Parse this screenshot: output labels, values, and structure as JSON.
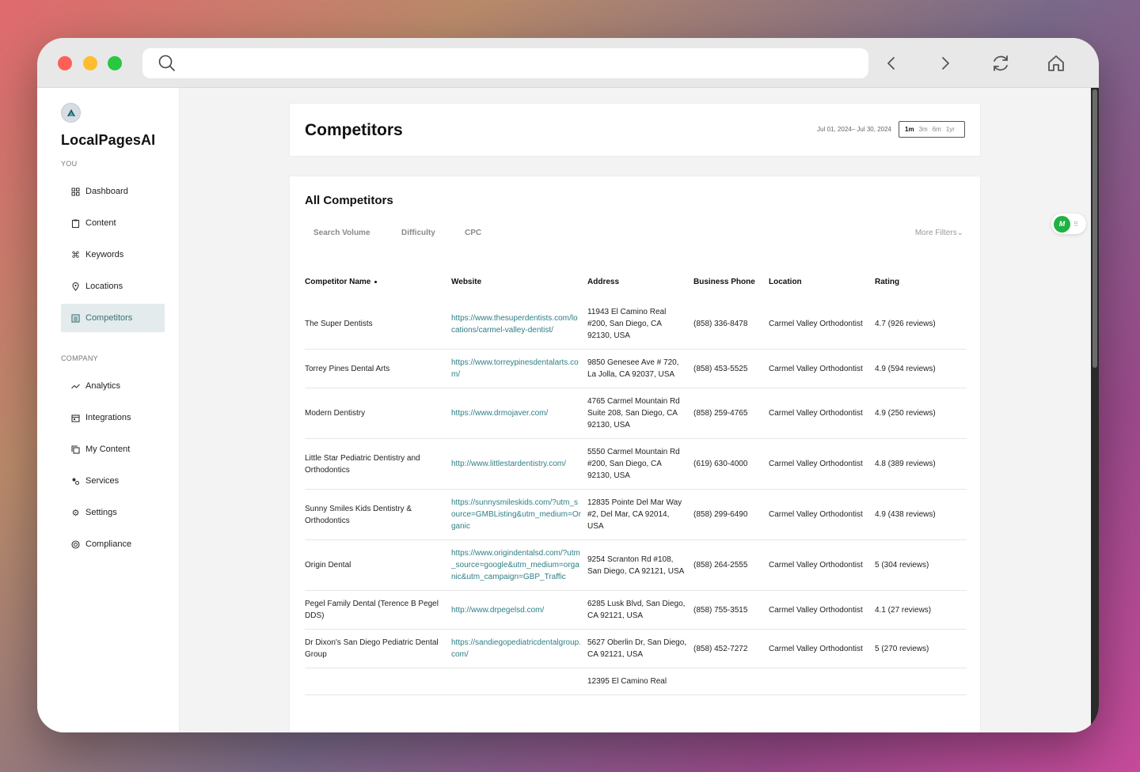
{
  "browser": {
    "url": ""
  },
  "sidebar": {
    "brand": "LocalPagesAI",
    "section_you": "YOU",
    "section_company": "COMPANY",
    "you_items": [
      {
        "label": "Dashboard",
        "icon": "grid-icon"
      },
      {
        "label": "Content",
        "icon": "clipboard-icon"
      },
      {
        "label": "Keywords",
        "icon": "command-icon"
      },
      {
        "label": "Locations",
        "icon": "pin-icon"
      },
      {
        "label": "Competitors",
        "icon": "list-icon",
        "active": true
      }
    ],
    "company_items": [
      {
        "label": "Analytics",
        "icon": "trend-icon"
      },
      {
        "label": "Integrations",
        "icon": "calendar-icon"
      },
      {
        "label": "My Content",
        "icon": "copy-icon"
      },
      {
        "label": "Services",
        "icon": "services-icon"
      },
      {
        "label": "Settings",
        "icon": "gear-icon"
      },
      {
        "label": "Compliance",
        "icon": "badge-icon"
      }
    ]
  },
  "header": {
    "title": "Competitors",
    "date_range": "Jul 01, 2024– Jul 30, 2024",
    "ranges": [
      "1m",
      "3m",
      "6m",
      "1yr"
    ],
    "selected_range": "1m"
  },
  "competitors": {
    "title": "All Competitors",
    "filters": [
      "Search Volume",
      "Difficulty",
      "CPC"
    ],
    "more_filters": "More Filters",
    "columns": [
      "Competitor Name",
      "Website",
      "Address",
      "Business Phone",
      "Location",
      "Rating"
    ],
    "rows": [
      {
        "name": "The Super Dentists",
        "website": "https://www.thesuperdentists.com/locations/carmel-valley-dentist/",
        "address": "11943 El Camino Real #200, San Diego, CA 92130, USA",
        "phone": "(858) 336-8478",
        "location": "Carmel Valley Orthodontist",
        "rating": "4.7 (926 reviews)"
      },
      {
        "name": "Torrey Pines Dental Arts",
        "website": "https://www.torreypinesdentalarts.com/",
        "address": "9850 Genesee Ave # 720, La Jolla, CA 92037, USA",
        "phone": "(858) 453-5525",
        "location": "Carmel Valley Orthodontist",
        "rating": "4.9 (594 reviews)"
      },
      {
        "name": "Modern Dentistry",
        "website": "https://www.drmojaver.com/",
        "address": "4765 Carmel Mountain Rd Suite 208, San Diego, CA 92130, USA",
        "phone": "(858) 259-4765",
        "location": "Carmel Valley Orthodontist",
        "rating": "4.9 (250 reviews)"
      },
      {
        "name": "Little Star Pediatric Dentistry and Orthodontics",
        "website": "http://www.littlestardentistry.com/",
        "address": "5550 Carmel Mountain Rd #200, San Diego, CA 92130, USA",
        "phone": "(619) 630-4000",
        "location": "Carmel Valley Orthodontist",
        "rating": "4.8 (389 reviews)"
      },
      {
        "name": "Sunny Smiles Kids Dentistry & Orthodontics",
        "website": "https://sunnysmileskids.com/?utm_source=GMBListing&utm_medium=Organic",
        "address": "12835 Pointe Del Mar Way #2, Del Mar, CA 92014, USA",
        "phone": "(858) 299-6490",
        "location": "Carmel Valley Orthodontist",
        "rating": "4.9 (438 reviews)"
      },
      {
        "name": "Origin Dental",
        "website": "https://www.origindentalsd.com/?utm_source=google&utm_medium=organic&utm_campaign=GBP_Traffic",
        "address": "9254 Scranton Rd #108, San Diego, CA 92121, USA",
        "phone": "(858) 264-2555",
        "location": "Carmel Valley Orthodontist",
        "rating": "5 (304 reviews)"
      },
      {
        "name": "Pegel Family Dental (Terence B Pegel DDS)",
        "website": "http://www.drpegelsd.com/",
        "address": "6285 Lusk Blvd, San Diego, CA 92121, USA",
        "phone": "(858) 755-3515",
        "location": "Carmel Valley Orthodontist",
        "rating": "4.1 (27 reviews)"
      },
      {
        "name": "Dr Dixon's San Diego Pediatric Dental Group",
        "website": "https://sandiegopediatricdentalgroup.com/",
        "address": "5627 Oberlin Dr, San Diego, CA 92121, USA",
        "phone": "(858) 452-7272",
        "location": "Carmel Valley Orthodontist",
        "rating": "5 (270 reviews)"
      },
      {
        "name": "",
        "website": "",
        "address": "12395 El Camino Real",
        "phone": "",
        "location": "",
        "rating": ""
      }
    ]
  },
  "extension": {
    "label": "M"
  }
}
